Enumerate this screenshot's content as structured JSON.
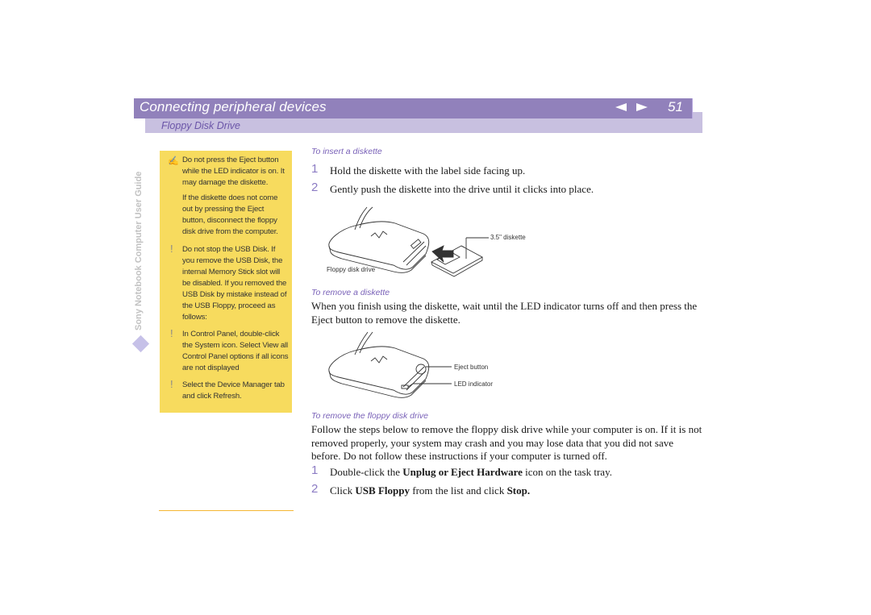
{
  "header": {
    "chapter_title": "Connecting peripheral devices",
    "prev_icon": "triangle-left-icon",
    "next_icon": "triangle-right-icon",
    "page_number": "51",
    "section_title": "Floppy Disk Drive",
    "colors": {
      "bar": "#9181bb",
      "subbar": "#c8c0e0",
      "accent": "#7a62b8"
    }
  },
  "sidebar": {
    "guide_label": "Sony Notebook Computer User Guide",
    "diamond_icon": "diamond-icon"
  },
  "notes": {
    "background_color": "#f7db5e",
    "items": [
      {
        "icon": "pen-note-icon",
        "glyph": "✍",
        "text": "Do not press the Eject button while the LED indicator is on. It may damage the diskette."
      },
      {
        "icon": "",
        "glyph": "",
        "text": "If the diskette does not come out by pressing the Eject button, disconnect the floppy disk drive from the computer."
      },
      {
        "icon": "exclamation-icon",
        "glyph": "!",
        "text": "Do not stop the USB Disk. If you remove the USB Disk, the internal Memory Stick slot will be disabled. If you removed the USB Disk by mistake instead of the USB Floppy, proceed as follows:"
      },
      {
        "icon": "exclamation-icon",
        "glyph": "!",
        "text": "In Control Panel, double-click the System icon. Select View all Control Panel options if all icons are not displayed"
      },
      {
        "icon": "exclamation-icon",
        "glyph": "!",
        "text": "Select the Device Manager tab and click Refresh."
      }
    ]
  },
  "main": {
    "insert": {
      "heading": "To insert a diskette",
      "steps": [
        {
          "num": "1",
          "text": "Hold the diskette with the label side facing up."
        },
        {
          "num": "2",
          "text": "Gently push the diskette into the drive until it clicks into place."
        }
      ],
      "figure_labels": {
        "diskette": "3.5\" diskette",
        "drive": "Floppy disk drive"
      }
    },
    "remove_diskette": {
      "heading": "To remove a diskette",
      "paragraph": "When you finish using the diskette, wait until the LED indicator turns off and then press the Eject button to remove the diskette.",
      "figure_labels": {
        "eject": "Eject button",
        "led": "LED indicator"
      }
    },
    "remove_drive": {
      "heading": "To remove the floppy disk drive",
      "paragraph": "Follow the steps below to remove the floppy disk drive while your computer is on. If it is not removed properly, your system may crash and you may lose data that you did not save before. Do not follow these instructions if your computer is turned off.",
      "steps": [
        {
          "num": "1",
          "pre": "Double-click the ",
          "bold": "Unplug or Eject Hardware",
          "post": " icon on the task tray."
        },
        {
          "num": "2",
          "pre": "Click ",
          "bold": "USB Floppy",
          "mid": " from the list and click ",
          "bold2": "Stop."
        }
      ]
    }
  }
}
